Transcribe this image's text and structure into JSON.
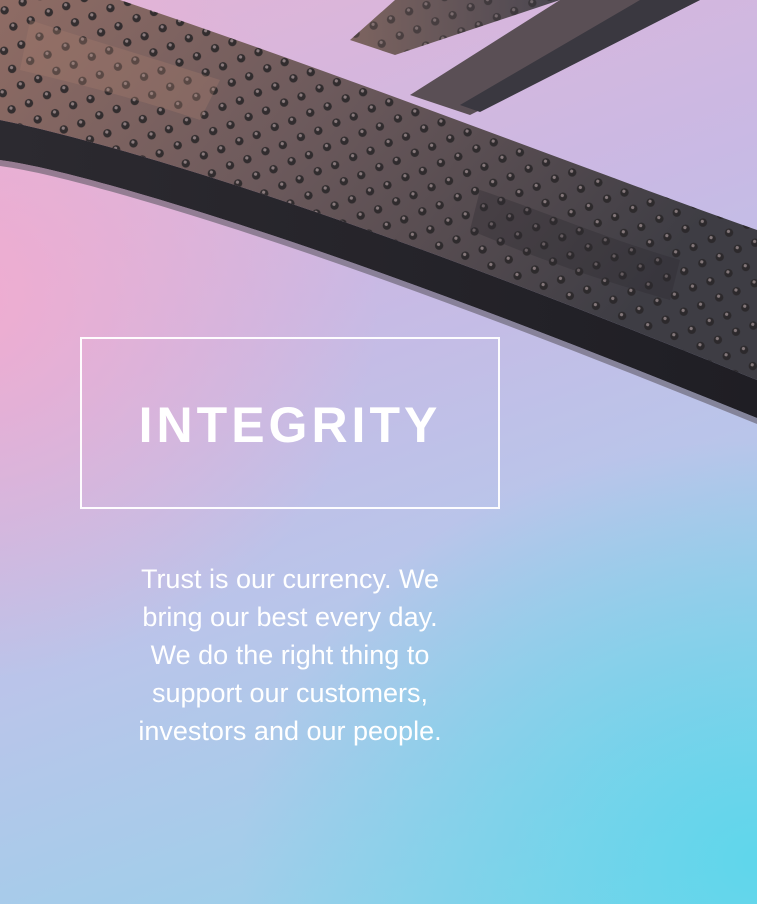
{
  "heading": "INTEGRITY",
  "body_lines": [
    "Trust is our currency. We",
    "bring our best every day.",
    "We do the right thing to",
    "support our customers,",
    "investors and our people."
  ],
  "photo": {
    "subject": "riveted-steel-bridge-girder",
    "colors": {
      "sky_pink": "#e8a8cf",
      "sky_lavender": "#c6b9e4",
      "sky_cyan": "#79d6ea",
      "steel_dark": "#3d3a3f",
      "steel_rust": "#8a6a62",
      "text": "#ffffff"
    }
  }
}
